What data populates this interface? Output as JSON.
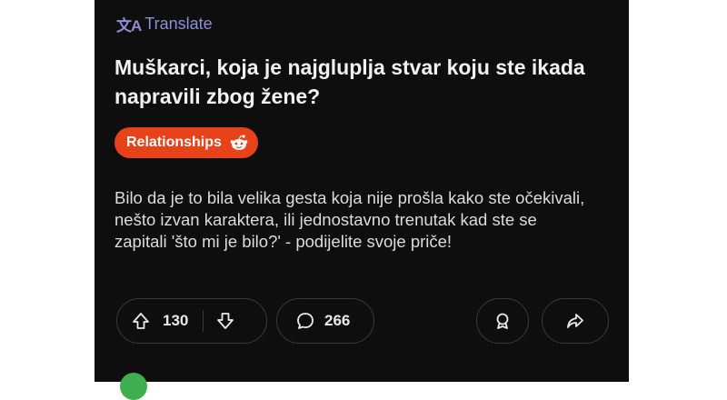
{
  "translate": {
    "label": "Translate"
  },
  "post": {
    "title": "Muškarci, koja je najgluplja stvar koju ste ikada napravili zbog žene?",
    "flair": "Relationships",
    "body": "Bilo da je to bila velika gesta koja nije prošla kako ste očekivali, nešto izvan karaktera, ili jednostavno trenutak kad ste se zapitali 'što mi je bilo?' - podijelite svoje priče!"
  },
  "actions": {
    "upvotes": "130",
    "comments": "266"
  },
  "colors": {
    "background": "#0e0e0e",
    "flair": "#e8421a",
    "translate": "#8d8fd6",
    "pill_border": "#3a3a3a"
  },
  "icons": [
    "translate-icon",
    "snoo-icon",
    "upvote-icon",
    "downvote-icon",
    "comment-icon",
    "award-icon",
    "share-icon"
  ]
}
